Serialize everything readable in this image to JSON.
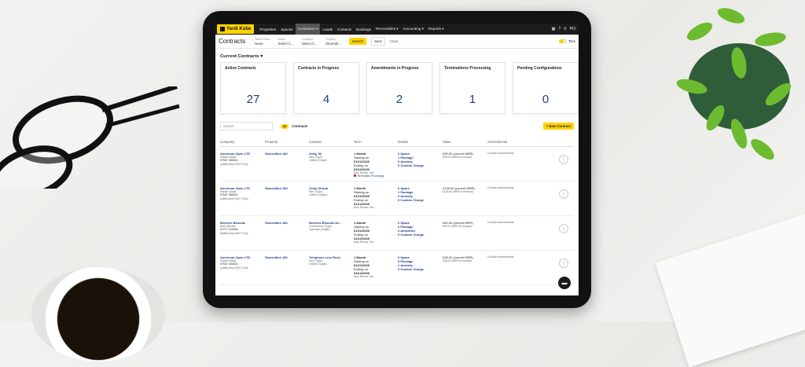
{
  "nav": {
    "logo": "Yardi Kube",
    "items": [
      "Properties",
      "Spaces",
      "Customers ▾",
      "Leads",
      "Contacts",
      "Bookings",
      "Receivables ▾",
      "Accounting ▾",
      "Reports ▾"
    ],
    "user": "PO"
  },
  "filterbar": {
    "title": "Contracts",
    "filters": [
      {
        "label": "Saved Filters",
        "value": "None"
      },
      {
        "label": "Name",
        "value": "Select C..."
      },
      {
        "label": "Company",
        "value": "Select C..."
      },
      {
        "label": "Property",
        "value": "Shoredit..."
      }
    ],
    "search_btn": "Search",
    "save_btn": "Save",
    "clear_btn": "Clear",
    "tiles_label": "Tiles"
  },
  "section_title": "Current Contracts ▾",
  "cards": [
    {
      "title": "Active Contracts",
      "value": "27"
    },
    {
      "title": "Contracts in Progress",
      "value": "4"
    },
    {
      "title": "Amendments in Progress",
      "value": "2"
    },
    {
      "title": "Terminations Processing",
      "value": "1"
    },
    {
      "title": "Pending Configurations",
      "value": "0"
    }
  ],
  "search": {
    "placeholder": "Search",
    "count": "33",
    "count_label": "Contracts",
    "new_btn": "+ New Contract"
  },
  "columns": [
    "Company",
    "Property",
    "Contract",
    "Term",
    "Details",
    "Value",
    "Amendments"
  ],
  "rows": [
    {
      "company": "American Open LTD",
      "contact": "Rafael Nadal",
      "phone": "07947 354304",
      "email": "judithhorley1967+21@...",
      "property": "Shoreditch 180",
      "contract": "Zesty 50",
      "type": "Hire (Type)",
      "origin": "Online (Origin)",
      "term": "1 Month",
      "start_lbl": "Starting on",
      "start": "01/12/2020",
      "end_lbl": "Ending on",
      "end": "02/12/2020",
      "renew": "Auto Renew: Yes",
      "term_extra": "Termination Processing",
      "d1": "0 Space",
      "d2": "1 Package",
      "d3": "0 Amenity",
      "d4": "0 Custom Charge",
      "value": "£99.00 (current MRR)",
      "value2": "£99.00 (MRR at renewal)",
      "amend": "0 Active Amendments"
    },
    {
      "company": "American Open LTD",
      "contact": "Rafael Nadal",
      "phone": "07947 354304",
      "email": "judithhorley1967+21@...",
      "property": "Shoreditch 180",
      "contract": "Zesty Virtual",
      "type": "Hire (Type)",
      "origin": "Online (Origin)",
      "term": "1 Month",
      "start_lbl": "Starting on",
      "start": "01/12/2020",
      "end_lbl": "Ending on",
      "end": "31/12/2020",
      "renew": "Auto Renew: Yes",
      "term_extra": "",
      "d1": "0 Space",
      "d2": "1 Package",
      "d3": "0 Amenity",
      "d4": "0 Custom Charge",
      "value": "£139.00 (current MRR)",
      "value2": "£139.00 (MRR at renewal)",
      "amend": "0 Active Amendments"
    },
    {
      "company": "Beckers Biscuits",
      "contact": "Boris Becker",
      "phone": "07777 123456",
      "email": "judithhorley1967+21@...",
      "property": "Shoreditch 180",
      "contract": "Beckers Biscuits De...",
      "type": "Contraction (Type)",
      "origin": "Operator (Origin)",
      "term": "1 Month",
      "start_lbl": "Starting on",
      "start": "01/12/2020",
      "end_lbl": "Ending on",
      "end": "31/12/2020",
      "renew": "Auto Renew: Yes",
      "term_extra": "",
      "d1": "0 Space",
      "d2": "0 Package",
      "d3": "3 Amenities",
      "d4": "0 Custom Charge",
      "value": "£60.00 (current MRR)",
      "value2": "£60.00 (MRR at renewal)",
      "amend": "0 Active Amendments"
    },
    {
      "company": "American Open LTD",
      "contact": "Rafael Nadal",
      "phone": "07947 354304",
      "email": "judithhorley1967+21@...",
      "property": "Shoreditch 180",
      "contract": "Telephone Line Rent...",
      "type": "Hire (Type)",
      "origin": "Online (Origin)",
      "term": "1 Month",
      "start_lbl": "Starting on",
      "start": "01/12/2020",
      "end_lbl": "Ending on",
      "end": "31/12/2020",
      "renew": "Auto Renew: Yes",
      "term_extra": "",
      "d1": "0 Space",
      "d2": "0 Package",
      "d3": "1 Amenity",
      "d4": "0 Custom Charge",
      "value": "£28.00 (current MRR)",
      "value2": "£28.00 (MRR at renewal)",
      "amend": "0 Active Amendments"
    }
  ]
}
